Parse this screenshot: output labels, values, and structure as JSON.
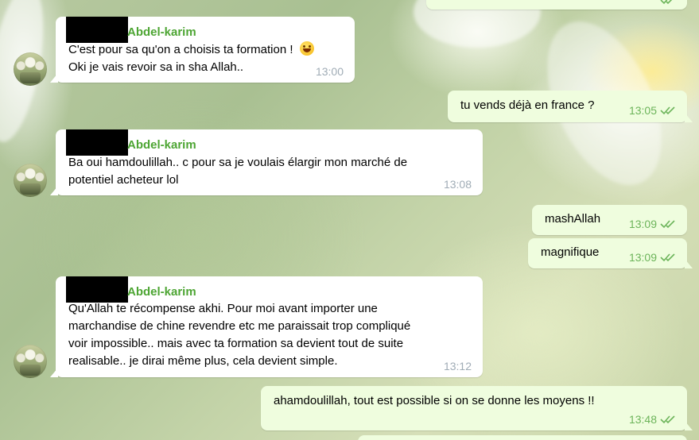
{
  "chat": {
    "messages": [
      {
        "direction": "in",
        "sender": "Abdel-karim",
        "lines": [
          "C'est pour sa qu'on a choisis ta formation ! ",
          "Oki je vais revoir sa in sha Allah.."
        ],
        "emoji": "grinning-face-emoji",
        "time": "13:00"
      },
      {
        "direction": "out",
        "lines": [
          "tu vends déjà en france ?"
        ],
        "time": "13:05",
        "status": "read"
      },
      {
        "direction": "in",
        "sender": "Abdel-karim",
        "lines": [
          "Ba oui hamdoulillah.. c pour sa je voulais élargir mon marché de",
          "potentiel acheteur lol"
        ],
        "time": "13:08"
      },
      {
        "direction": "out",
        "lines": [
          "mashAllah"
        ],
        "time": "13:09",
        "status": "read"
      },
      {
        "direction": "out",
        "lines": [
          "magnifique"
        ],
        "time": "13:09",
        "status": "read"
      },
      {
        "direction": "in",
        "sender": "Abdel-karim",
        "lines": [
          "Qu'Allah te récompense akhi. Pour moi avant importer une",
          "marchandise de chine revendre etc me paraissait trop compliqué",
          "voir impossible.. mais avec ta formation sa devient tout de suite",
          "realisable.. je dirai même plus, cela devient simple."
        ],
        "time": "13:12"
      },
      {
        "direction": "out",
        "lines": [
          "ahamdoulillah, tout est possible si on se donne les moyens !!"
        ],
        "time": "13:48",
        "status": "read"
      }
    ]
  },
  "colors": {
    "incoming_bubble": "#ffffff",
    "outgoing_bubble": "#effdde",
    "sender_name": "#4da533",
    "outgoing_time": "#6cb45a",
    "incoming_time": "#a0acb6"
  }
}
